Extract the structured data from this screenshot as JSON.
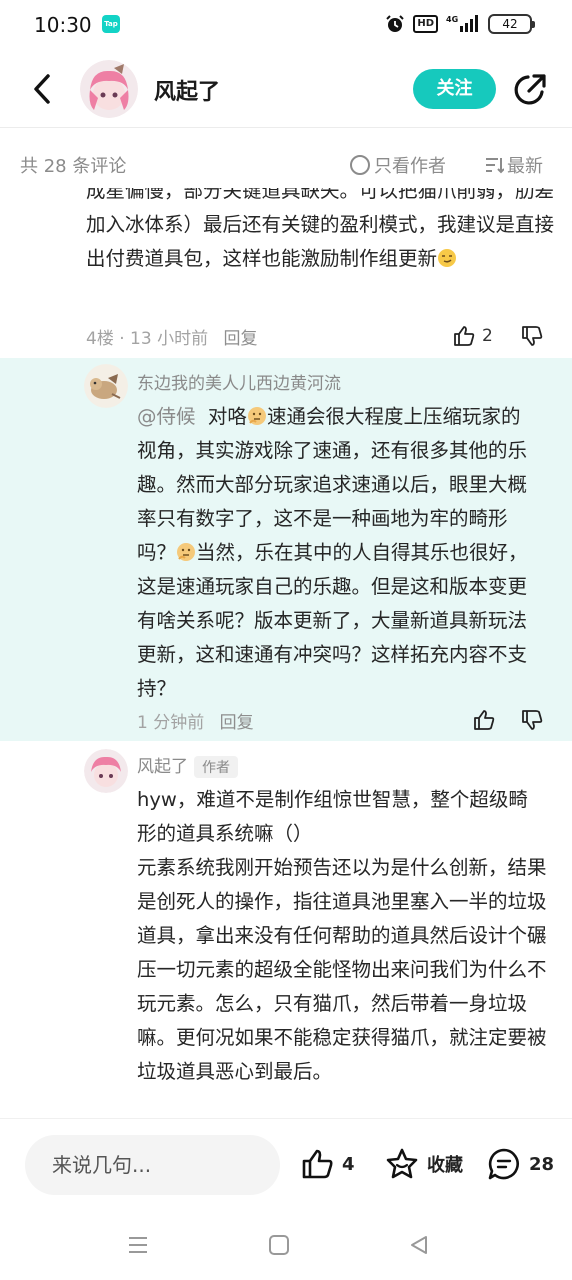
{
  "status_bar": {
    "time": "10:30",
    "app_badge": "Tap",
    "hd_label": "HD",
    "network": "4G",
    "battery": "42"
  },
  "header": {
    "username": "风起了",
    "follow_label": "关注"
  },
  "filter": {
    "comment_count": "共 28 条评论",
    "author_only_label": "只看作者",
    "sort_label": "最新"
  },
  "comments": [
    {
      "text": "成星偏慢，部分关键道具缺失。可以把猫爪削弱，肋差加入冰体系）最后还有关键的盈利模式，我建议是直接出付费道具包，这样也能激励制作组更新",
      "meta": "4楼 · 13 小时前",
      "reply_label": "回复",
      "likes": "2"
    },
    {
      "username": "东边我的美人儿西边黄河流",
      "mention": "@侍候",
      "text_1": "对咯",
      "text_2": "速通会很大程度上压缩玩家的视角，其实游戏除了速通，还有很多其他的乐趣。然而大部分玩家追求速通以后，眼里大概率只有数字了，这不是一种画地为牢的畸形吗？",
      "text_3": "当然，乐在其中的人自得其乐也很好，这是速通玩家自己的乐趣。但是这和版本变更有啥关系呢？版本更新了，大量新道具新玩法更新，这和速通有冲突吗？这样拓充内容不支持？",
      "meta": "1 分钟前",
      "reply_label": "回复"
    },
    {
      "username": "风起了",
      "badge": "作者",
      "text": "hyw，难道不是制作组惊世智慧，整个超级畸形的道具系统嘛（）\n元素系统我刚开始预告还以为是什么创新，结果是创死人的操作，指往道具池里塞入一半的垃圾道具，拿出来没有任何帮助的道具然后设计个碾压一切元素的超级全能怪物出来问我们为什么不玩元素。怎么，只有猫爪，然后带着一身垃圾嘛。更何况如果不能稳定获得猫爪，就注定要被垃圾道具恶心到最后。"
    }
  ],
  "bottom_bar": {
    "input_placeholder": "来说几句...",
    "likes": "4",
    "favorite_label": "收藏",
    "comments": "28"
  },
  "colors": {
    "accent": "#16c9bd",
    "highlight_bg": "#e8f8f6"
  }
}
